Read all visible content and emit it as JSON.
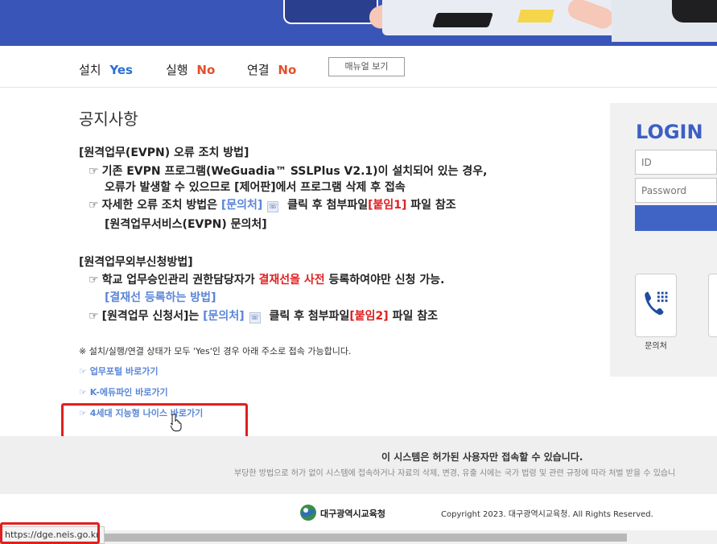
{
  "status_bar": {
    "install_label": "설치",
    "install_value": "Yes",
    "run_label": "실행",
    "run_value": "No",
    "connect_label": "연결",
    "connect_value": "No",
    "manual_button": "매뉴얼 보기"
  },
  "notice": {
    "title": "공지사항",
    "sec1_title": "[원격업무(EVPN) 오류 조치 방법]",
    "sec1_l1": "기존 EVPN 프로그램(WeGuadia™ SSLPlus V2.1)이 설치되어 있는 경우,",
    "sec1_l2": "오류가 발생할 수 있으므로 [제어판]에서 프로그램 삭제 후 접속",
    "sec1_l3_a": "자세한 오류 조치 방법은 ",
    "sec1_l3_link": "[문의처]",
    "sec1_l3_b": " 클릭 후 첨부파일",
    "sec1_l3_red": "[붙임1]",
    "sec1_l3_c": " 파일 참조",
    "sec1_l4": "[원격업무서비스(EVPN) 문의처]",
    "sec2_title": "[원격업무외부신청방법]",
    "sec2_l1_a": "학교 업무승인관리 권한담당자가 ",
    "sec2_l1_red": "결재선을 사전",
    "sec2_l1_b": " 등록하여야만 신청 가능.",
    "sec2_l2_link": "[결재선 등록하는 방법]",
    "sec2_l3_a": "[원격업무 신청서]는 ",
    "sec2_l3_link": "[문의처]",
    "sec2_l3_b": " 클릭 후 첨부파일",
    "sec2_l3_red": "[붙임2]",
    "sec2_l3_c": " 파일 참조",
    "hand_glyph": "☞",
    "phone_glyph": "☏",
    "notice_line": "※ 설치/실행/연결 상태가 모두 'Yes'인 경우 아래 주소로 접속 가능합니다."
  },
  "quick_links": [
    {
      "label": "☞ 업무포털 바로가기"
    },
    {
      "label": "☞ K-에듀파인 바로가기"
    },
    {
      "label": "☞ 4세대 지능형 나이스 바로가기"
    }
  ],
  "login": {
    "title": "LOGIN",
    "id_placeholder": "ID",
    "password_placeholder": "Password",
    "contact_label": "문의처"
  },
  "footer": {
    "main": "이 시스템은 허가된 사용자만 접속할 수 있습니다.",
    "sub": "부당한 방법으로 허가 없이 시스템에 접속하거나 자료의 삭제, 변경, 유출 시에는 국가 법령 및 관련 규정에 따라 처벌 받을 수 있습니",
    "org": "대구광역시교육청",
    "copyright": "Copyright 2023. 대구광역시교육청. All Rights Reserved."
  },
  "browser_status": {
    "url": "https://dge.neis.go.kr"
  },
  "colors": {
    "yes": "#2a6fd1",
    "no": "#e2502a",
    "link": "#5a86d8",
    "red_emphasis": "#e02020",
    "login_accent": "#3b5fc4",
    "highlight": "#e0201e"
  }
}
